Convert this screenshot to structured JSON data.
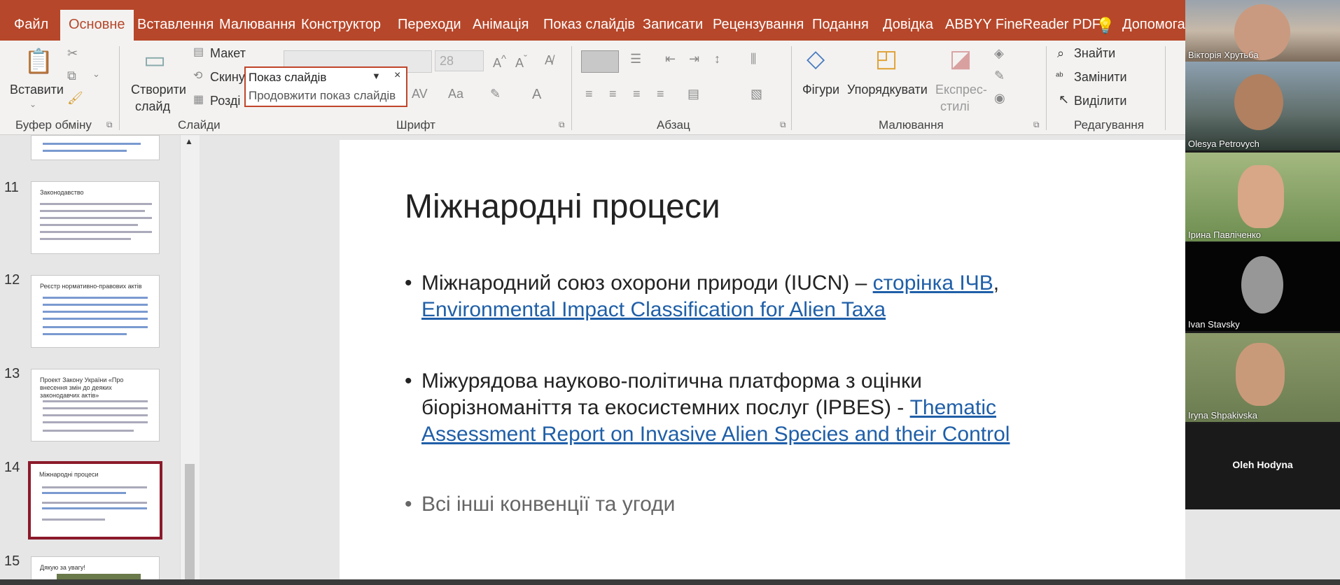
{
  "ribbon_tabs": [
    "Файл",
    "Основне",
    "Вставлення",
    "Малювання",
    "Конструктор",
    "Переходи",
    "Анімація",
    "Показ слайдів",
    "Записати",
    "Рецензування",
    "Подання",
    "Довідка",
    "ABBYY FineReader PDF"
  ],
  "help_label": "Допомога",
  "clipboard": {
    "paste": "Вставити",
    "group": "Буфер обміну"
  },
  "slides_group": {
    "new_slide_line1": "Створити",
    "new_slide_line2": "слайд",
    "layout": "Макет",
    "reset": "Скину",
    "section": "Розді",
    "group": "Слайди"
  },
  "font_group": {
    "size": "28",
    "group": "Шрифт"
  },
  "paragraph_group": {
    "group": "Абзац"
  },
  "drawing_group": {
    "shapes": "Фігури",
    "arrange": "Упорядкувати",
    "quick_styles_line1": "Експрес-",
    "quick_styles_line2": "стилі",
    "group": "Малювання"
  },
  "editing_group": {
    "find": "Знайти",
    "replace": "Замінити",
    "select": "Виділити",
    "group": "Редагування"
  },
  "popup": {
    "title": "Показ слайдів",
    "item": "Продовжити показ слайдів"
  },
  "thumbnails": [
    {
      "num": "11",
      "title": "Законодавство"
    },
    {
      "num": "12",
      "title": "Реєстр нормативно-правових актів"
    },
    {
      "num": "13",
      "title": "Проект Закону України «Про внесення змін до деяких законодавчих актів»"
    },
    {
      "num": "14",
      "title": "Міжнародні процеси"
    },
    {
      "num": "15",
      "title": "Дякую за увагу!"
    }
  ],
  "slide": {
    "title": "Міжнародні процеси",
    "bullet1_text": "Міжнародний союз охорони природи (IUCN) – ",
    "bullet1_link1": "сторінка ІЧВ",
    "bullet1_comma": ",",
    "bullet1_link2": "Environmental Impact Classification for Alien Taxa",
    "bullet2_line1": "Міжурядова науково-політична платформа з оцінки",
    "bullet2_line2_text": "біорізноманіття та екосистемних послуг (IPBES) - ",
    "bullet2_link_line1": "Thematic",
    "bullet2_link_line2": "Assessment Report on Invasive Alien Species and their Control",
    "bullet3": "Всі інші конвенції та угоди"
  },
  "participants": [
    "Вікторія Хрутьба",
    "Olesya Petrovych",
    "Ірина Павліченко",
    "Ivan Stavsky",
    "Iryna Shpakivska",
    "Oleh Hodyna"
  ],
  "colors": {
    "accent": "#b7472a",
    "link": "#1f5fa8"
  }
}
